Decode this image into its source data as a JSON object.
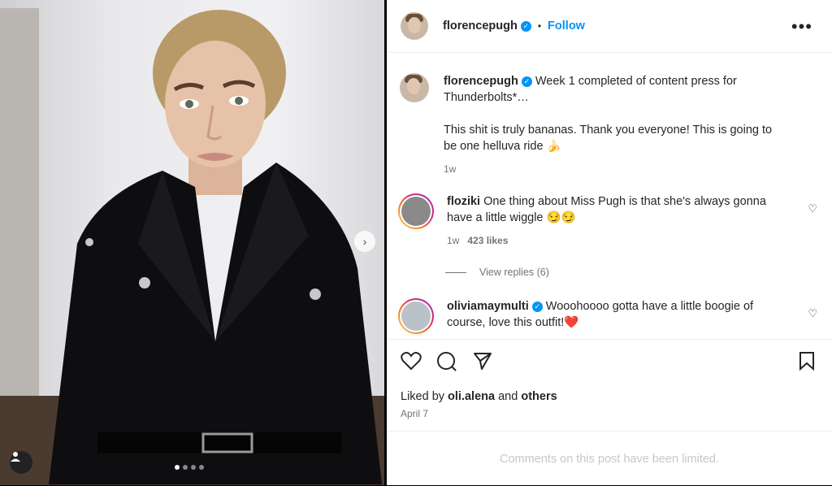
{
  "post": {
    "author": "florencepugh",
    "follow_label": "Follow",
    "caption_line1": "Week 1 completed of content press for Thunderbolts*…",
    "caption_line2": "This shit is truly bananas. Thank you everyone! This is going to be one helluva ride 🍌",
    "caption_time": "1w",
    "verified_mark": "✓",
    "more_icon": "•••",
    "carousel": {
      "count": 4,
      "active": 1
    },
    "colors": {
      "accent": "#0095f6",
      "heart_red": "#ed4956"
    }
  },
  "comments": [
    {
      "user": "floziki",
      "text": "One thing about Miss Pugh is that she's always gonna have a little wiggle 😏😏",
      "time": "1w",
      "likes": "423 likes",
      "view_replies": "View replies (6)"
    },
    {
      "user": "oliviamaymulti",
      "text": "Wooohoooo gotta have a little boogie of course, love this outfit!",
      "emoji": "❤️"
    }
  ],
  "engagement": {
    "liked_by_prefix": "Liked by",
    "liked_by_user": "oli.alena",
    "and_label": "and",
    "others_label": "others",
    "date": "April 7"
  },
  "footer": {
    "limited_text": "Comments on this post have been limited."
  }
}
